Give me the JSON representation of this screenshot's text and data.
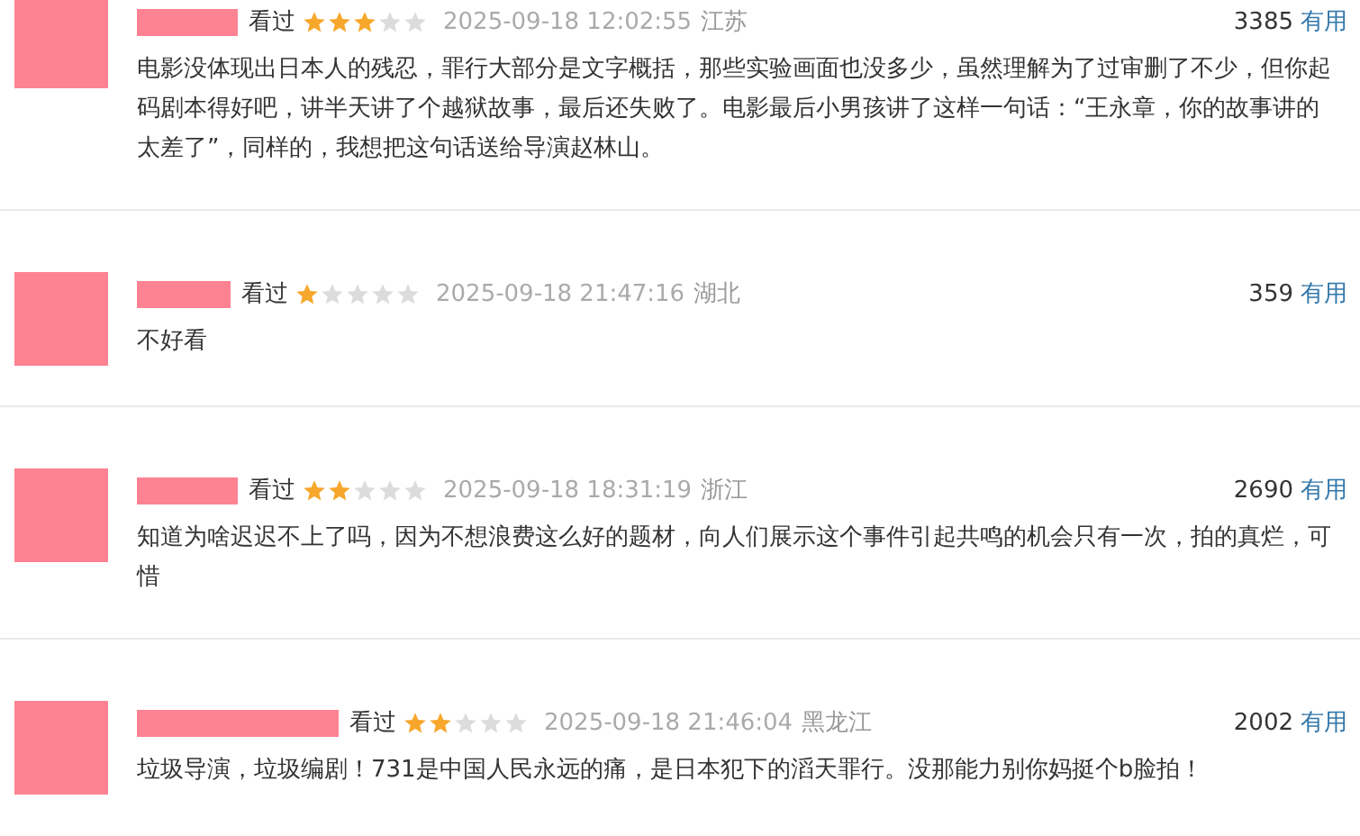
{
  "reviews": [
    {
      "status": "看过",
      "stars": 3,
      "time": "2025-09-18 12:02:55",
      "location": "江苏",
      "votes": "3385",
      "vote_label": "有用",
      "text": "电影没体现出日本人的残忍，罪行大部分是文字概括，那些实验画面也没多少，虽然理解为了过审删了不少，但你起码剧本得好吧，讲半天讲了个越狱故事，最后还失败了。电影最后小男孩讲了这样一句话：“王永章，你的故事讲的太差了”，同样的，我想把这句话送给导演赵林山。"
    },
    {
      "status": "看过",
      "stars": 1,
      "time": "2025-09-18 21:47:16",
      "location": "湖北",
      "votes": "359",
      "vote_label": "有用",
      "text": "不好看"
    },
    {
      "status": "看过",
      "stars": 2,
      "time": "2025-09-18 18:31:19",
      "location": "浙江",
      "votes": "2690",
      "vote_label": "有用",
      "text": "知道为啥迟迟不上了吗，因为不想浪费这么好的题材，向人们展示这个事件引起共鸣的机会只有一次，拍的真烂，可惜"
    },
    {
      "status": "看过",
      "stars": 2,
      "time": "2025-09-18 21:46:04",
      "location": "黑龙江",
      "votes": "2002",
      "vote_label": "有用",
      "text": "垃圾导演，垃圾编剧！731是中国人民永远的痛，是日本犯下的滔天罪行。没那能力别你妈挺个b脸拍！"
    }
  ]
}
